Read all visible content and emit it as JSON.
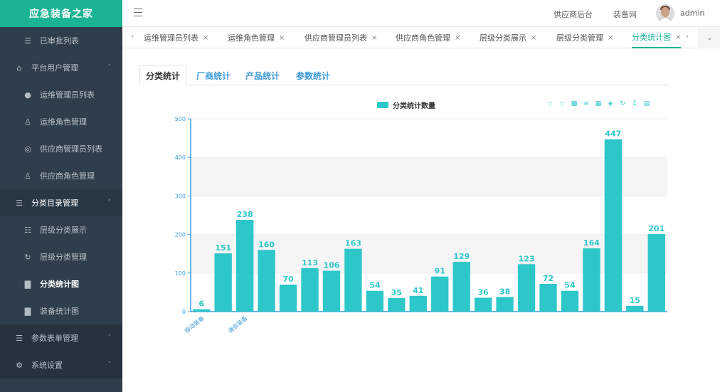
{
  "app": {
    "title": "应急装备之家"
  },
  "header": {
    "links": [
      "供应商后台",
      "装备网"
    ],
    "user": "admin"
  },
  "sidebar": {
    "items": [
      {
        "label": "已审批列表",
        "icon": "list-icon",
        "kind": "sub"
      },
      {
        "label": "平台用户管理",
        "icon": "lock-icon",
        "kind": "group"
      },
      {
        "label": "运维管理员列表",
        "icon": "user-icon",
        "kind": "sub"
      },
      {
        "label": "运维角色管理",
        "icon": "user-tie-icon",
        "kind": "sub"
      },
      {
        "label": "供应商管理员列表",
        "icon": "circle-user-icon",
        "kind": "sub"
      },
      {
        "label": "供应商角色管理",
        "icon": "user-tie-icon",
        "kind": "sub"
      },
      {
        "label": "分类目录管理",
        "icon": "list-icon",
        "kind": "section"
      },
      {
        "label": "层级分类展示",
        "icon": "hierarchy-icon",
        "kind": "sub"
      },
      {
        "label": "层级分类管理",
        "icon": "refresh-icon",
        "kind": "sub"
      },
      {
        "label": "分类统计图",
        "icon": "bar-chart-icon",
        "kind": "active"
      },
      {
        "label": "装备统计图",
        "icon": "bar-chart-icon",
        "kind": "sub"
      },
      {
        "label": "参数表单管理",
        "icon": "list-icon",
        "kind": "group"
      },
      {
        "label": "系统设置",
        "icon": "gear-icon",
        "kind": "group"
      }
    ]
  },
  "tabs": [
    {
      "label": "运维管理员列表"
    },
    {
      "label": "运维角色管理"
    },
    {
      "label": "供应商管理员列表"
    },
    {
      "label": "供应商角色管理"
    },
    {
      "label": "层级分类展示"
    },
    {
      "label": "层级分类管理"
    },
    {
      "label": "分类统计图",
      "active": true
    }
  ],
  "content_tabs": [
    "分类统计",
    "厂商统计",
    "产品统计",
    "参数统计"
  ],
  "colors": {
    "accent": "#1ab394",
    "bar": "#2ec7c9",
    "sidebar": "#2f3e4c",
    "link": "#3d9bd8"
  },
  "chart_data": {
    "type": "bar",
    "legend": "分类统计数量",
    "categories": [
      "移动装备",
      "",
      "通信装备",
      "",
      "",
      "",
      "",
      "",
      "",
      "",
      "",
      "",
      "",
      "",
      "",
      "",
      "",
      "",
      "",
      "",
      "",
      "",
      ""
    ],
    "values": [
      6,
      151,
      238,
      160,
      70,
      113,
      106,
      163,
      54,
      35,
      41,
      91,
      129,
      36,
      38,
      123,
      72,
      54,
      164,
      447,
      15,
      201
    ],
    "ylim": [
      0,
      500
    ],
    "yticks": [
      0,
      100,
      200,
      300,
      400,
      500
    ],
    "grid": true,
    "legend_position": "top-center"
  }
}
